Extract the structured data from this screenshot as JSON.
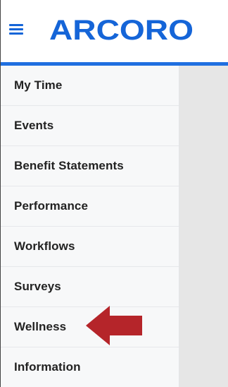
{
  "header": {
    "brand": "ARCORO",
    "menu_icon": "hamburger-menu-icon",
    "accent_color": "#1565d8"
  },
  "sidebar": {
    "items": [
      {
        "label": "My Time"
      },
      {
        "label": "Events"
      },
      {
        "label": "Benefit Statements"
      },
      {
        "label": "Performance"
      },
      {
        "label": "Workflows"
      },
      {
        "label": "Surveys"
      },
      {
        "label": "Wellness"
      },
      {
        "label": "Information"
      }
    ]
  },
  "annotation": {
    "icon": "red-arrow-left-icon",
    "color": "#b5252a",
    "points_to": "Wellness"
  }
}
